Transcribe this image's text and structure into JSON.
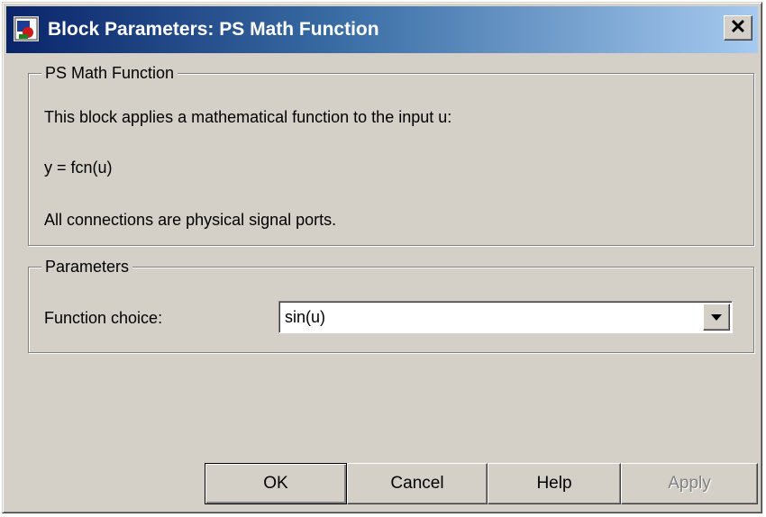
{
  "window": {
    "title": "Block Parameters: PS Math Function",
    "close_label": "✕"
  },
  "description_group": {
    "legend": "PS Math Function",
    "line1": "This block applies a mathematical function to the input u:",
    "line2": "y = fcn(u)",
    "line3": "All connections are physical signal ports."
  },
  "parameters_group": {
    "legend": "Parameters",
    "function_choice_label": "Function choice:",
    "function_choice_value": "sin(u)"
  },
  "buttons": {
    "ok": "OK",
    "cancel": "Cancel",
    "help": "Help",
    "apply": "Apply"
  },
  "icons": {
    "app": "simulink-block-icon",
    "close": "close-icon",
    "dropdown": "chevron-down-icon"
  },
  "colors": {
    "titlebar_start": "#0a246a",
    "titlebar_end": "#a6caf0",
    "dialog_face": "#d4d0c8"
  }
}
